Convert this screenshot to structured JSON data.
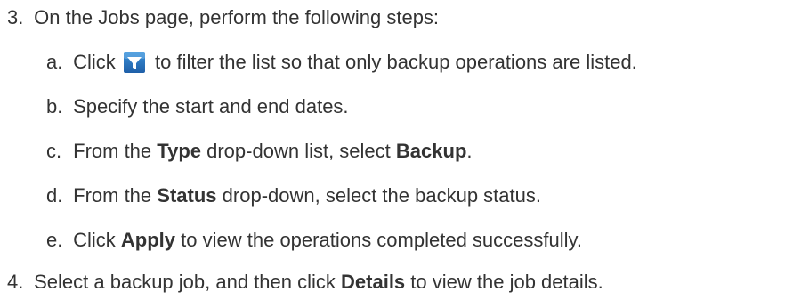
{
  "steps": [
    {
      "marker": "3.",
      "text": "On the Jobs page, perform the following steps:",
      "substeps": [
        {
          "marker": "a.",
          "before": "Click",
          "icon": "filter-icon",
          "after": "to filter the list so that only backup operations are listed."
        },
        {
          "marker": "b.",
          "text": "Specify the start and end dates."
        },
        {
          "marker": "c.",
          "t1": "From the",
          "b1": "Type",
          "t2": "drop-down list, select",
          "b2": "Backup",
          "t3": "."
        },
        {
          "marker": "d.",
          "t1": "From the",
          "b1": "Status",
          "t2": "drop-down, select the backup status."
        },
        {
          "marker": "e.",
          "t1": "Click",
          "b1": "Apply",
          "t2": "to view the operations completed successfully."
        }
      ]
    },
    {
      "marker": "4.",
      "t1": "Select a backup job, and then click",
      "b1": "Details",
      "t2": "to view the job details."
    }
  ],
  "colors": {
    "text": "#333333",
    "icon_bg_top": "#3a8fd6",
    "icon_bg_bottom": "#1f5fa8",
    "icon_funnel": "#ffffff"
  }
}
